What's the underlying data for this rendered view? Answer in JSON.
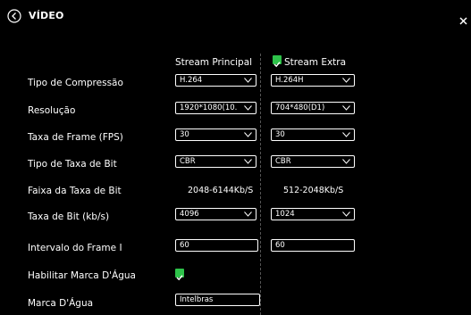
{
  "header": {
    "title": "VÍDEO"
  },
  "columns": {
    "principal": "Stream Principal",
    "extra": "Stream Extra",
    "extra_enabled": true
  },
  "rows": {
    "compression": {
      "label": "Tipo de Compressão",
      "principal": "H.264",
      "extra": "H.264H"
    },
    "resolution": {
      "label": "Resolução",
      "principal": "1920*1080(10...",
      "extra": "704*480(D1)"
    },
    "framerate": {
      "label": "Taxa de Frame (FPS)",
      "principal": "30",
      "extra": "30"
    },
    "bitrate_type": {
      "label": "Tipo de Taxa de Bit",
      "principal": "CBR",
      "extra": "CBR"
    },
    "bitrate_range": {
      "label": "Faixa da Taxa de Bit",
      "principal": "2048-6144Kb/S",
      "extra": "512-2048Kb/S"
    },
    "bitrate": {
      "label": "Taxa de Bit (kb/s)",
      "principal": "4096",
      "extra": "1024"
    },
    "iframe": {
      "label": "Intervalo do Frame I",
      "principal": "60",
      "extra": "60"
    },
    "watermark_enable": {
      "label": "Habilitar Marca D'Água",
      "checked": true
    },
    "watermark": {
      "label": "Marca D'Água",
      "value": "Intelbras"
    }
  },
  "colors": {
    "accent": "#2ec24a",
    "background": "#000000",
    "text": "#ffffff"
  },
  "icons": {
    "back": "back-circle-icon",
    "close": "close-icon",
    "dropdown": "chevron-down-icon",
    "check": "check-icon"
  }
}
